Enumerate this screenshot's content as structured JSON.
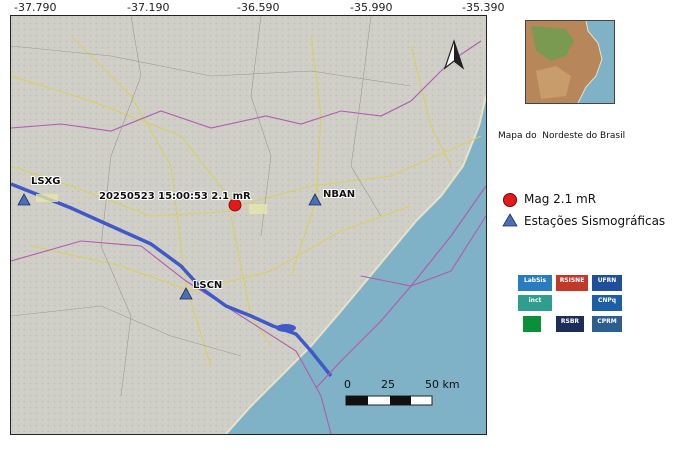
{
  "map": {
    "longitude_ticks": [
      "-37.790",
      "-37.190",
      "-36.590",
      "-35.990",
      "-35.390"
    ],
    "event_label": "20250523 15:00:53 2.1 mR",
    "stations": [
      {
        "code": "LSXG"
      },
      {
        "code": "NBAN"
      },
      {
        "code": "LSCN"
      }
    ],
    "scale_bar": {
      "labels": [
        "0",
        "25",
        "50 km"
      ]
    },
    "north_arrow": "north-arrow-icon"
  },
  "inset": {
    "caption": "Mapa do  Nordeste do Brasil"
  },
  "legend": {
    "event": {
      "label": "Mag 2.1 mR",
      "color": "#e31a1c"
    },
    "station": {
      "label": "Estações Sismográficas",
      "color": "#4a6fb5"
    }
  },
  "logos": {
    "items": [
      "LabSis",
      "RSISNE",
      "UFRN",
      "inct",
      "CNPq",
      "RSBR",
      "CPRM"
    ]
  },
  "colors": {
    "ocean": "#7fb2c6",
    "land": "#cfcfc7",
    "river": "#3f59c8",
    "boundary": "#b25bb0"
  }
}
